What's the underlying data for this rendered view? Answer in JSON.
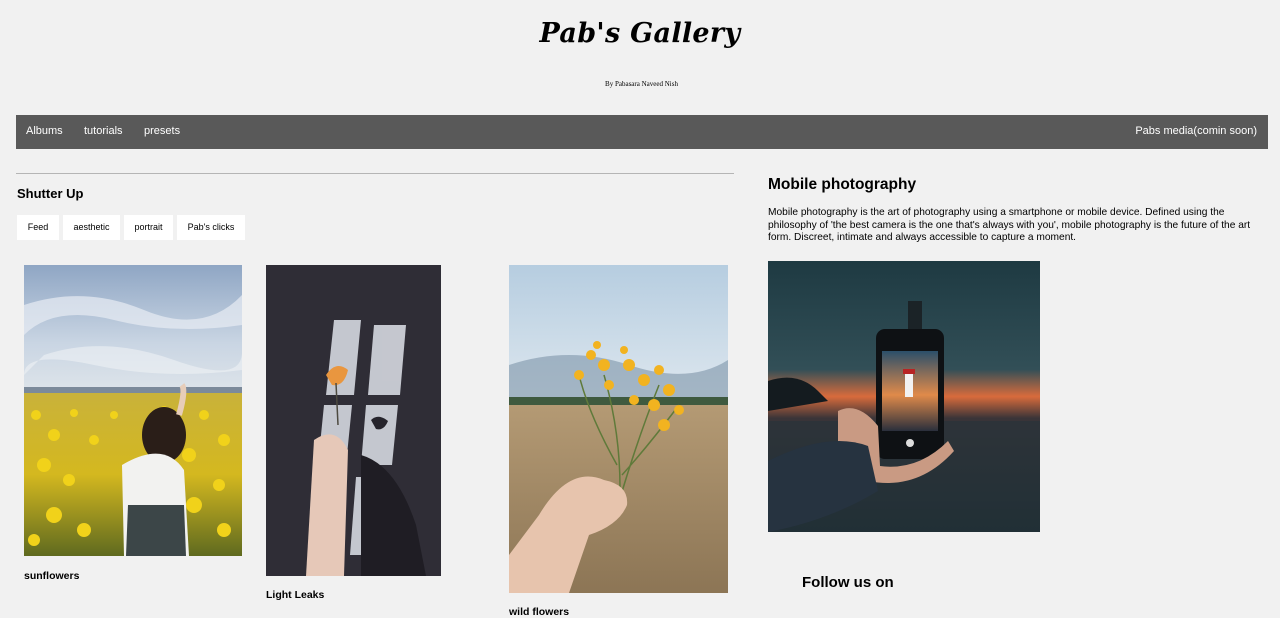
{
  "header": {
    "title": "Pab's Gallery",
    "byline": "By Pabasara Naveed Nish"
  },
  "nav": {
    "items": [
      "Albums",
      "tutorials",
      "presets"
    ],
    "right_item": "Pabs media(comin soon)"
  },
  "gallery": {
    "section_title": "Shutter Up",
    "filters": [
      "Feed",
      "aesthetic",
      "portrait",
      "Pab's clicks"
    ],
    "photos": [
      {
        "caption": "sunflowers",
        "subject": "person-in-yellow-flower-field"
      },
      {
        "caption": "Light Leaks",
        "subject": "hand-holding-flower-in-window-light"
      },
      {
        "caption": "wild flowers",
        "subject": "hand-holding-wildflowers-in-field"
      }
    ]
  },
  "aside": {
    "title": "Mobile photography",
    "text": "Mobile photography is the art of photography using a smartphone or mobile device. Defined using the philosophy of 'the best camera is the one that's always with you', mobile photography is the future of the art form. Discreet, intimate and always accessible to capture a moment.",
    "image_subject": "hand-holding-phone-photographing-lighthouse-sunset",
    "follow_title": "Follow us on"
  },
  "colors": {
    "page_bg": "#f1f1f1",
    "nav_bg": "#595959",
    "nav_text": "#ffffff",
    "filter_bg": "#ffffff"
  }
}
